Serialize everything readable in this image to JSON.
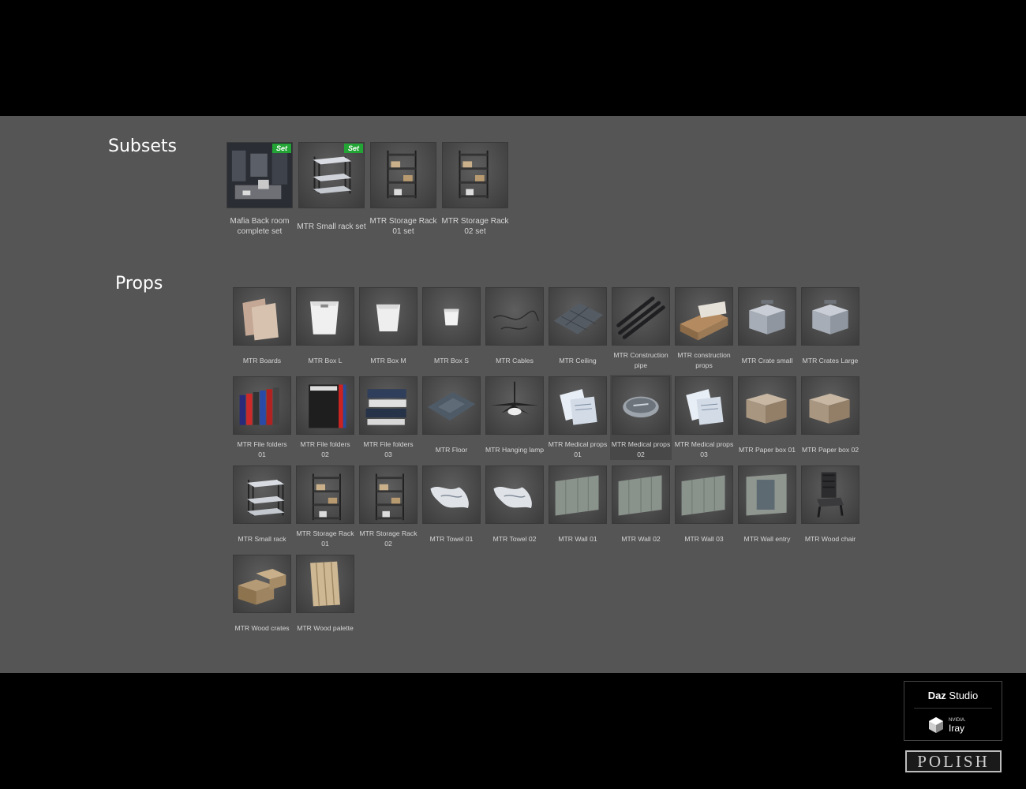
{
  "sections": {
    "subsets_title": "Subsets",
    "props_title": "Props"
  },
  "subsets": [
    {
      "lines": [
        "Mafia Back room",
        "complete set"
      ],
      "badge": "Set",
      "icon": "back-room-scene"
    },
    {
      "lines": [
        "MTR Small rack set"
      ],
      "badge": "Set",
      "icon": "small-rack"
    },
    {
      "lines": [
        "MTR Storage Rack",
        "01 set"
      ],
      "badge": "",
      "icon": "storage-rack"
    },
    {
      "lines": [
        "MTR Storage Rack",
        "02 set"
      ],
      "badge": "",
      "icon": "storage-rack"
    }
  ],
  "props": [
    {
      "lines": [
        "MTR Boards"
      ],
      "icon": "boards"
    },
    {
      "lines": [
        "MTR Box L"
      ],
      "icon": "box-large"
    },
    {
      "lines": [
        "MTR Box M"
      ],
      "icon": "box-medium"
    },
    {
      "lines": [
        "MTR Box S"
      ],
      "icon": "box-small"
    },
    {
      "lines": [
        "MTR Cables"
      ],
      "icon": "cables"
    },
    {
      "lines": [
        "MTR Ceiling"
      ],
      "icon": "ceiling"
    },
    {
      "lines": [
        "MTR Construction",
        "pipe"
      ],
      "icon": "pipes"
    },
    {
      "lines": [
        "MTR construction",
        "props"
      ],
      "icon": "lumber"
    },
    {
      "lines": [
        "MTR Crate small"
      ],
      "icon": "metal-crate"
    },
    {
      "lines": [
        "MTR Crates Large"
      ],
      "icon": "metal-crate"
    },
    {
      "lines": [
        "MTR File folders",
        "01"
      ],
      "icon": "file-folders"
    },
    {
      "lines": [
        "MTR File folders",
        "02"
      ],
      "icon": "binder"
    },
    {
      "lines": [
        "MTR File folders",
        "03"
      ],
      "icon": "folder-stack"
    },
    {
      "lines": [
        "MTR Floor"
      ],
      "icon": "floor"
    },
    {
      "lines": [
        "MTR Hanging lamp"
      ],
      "icon": "ceiling-fan"
    },
    {
      "lines": [
        "MTR Medical props",
        "01"
      ],
      "icon": "papers"
    },
    {
      "lines": [
        "MTR Medical props",
        "02"
      ],
      "icon": "bowl"
    },
    {
      "lines": [
        "MTR Medical props",
        "03"
      ],
      "icon": "papers"
    },
    {
      "lines": [
        "MTR Paper box 01"
      ],
      "icon": "cardboard-box"
    },
    {
      "lines": [
        "MTR Paper box 02"
      ],
      "icon": "cardboard-box"
    },
    {
      "lines": [
        "MTR Small rack"
      ],
      "icon": "small-rack"
    },
    {
      "lines": [
        "MTR Storage Rack",
        "01"
      ],
      "icon": "storage-rack"
    },
    {
      "lines": [
        "MTR Storage Rack",
        "02"
      ],
      "icon": "storage-rack"
    },
    {
      "lines": [
        "MTR Towel 01"
      ],
      "icon": "towel"
    },
    {
      "lines": [
        "MTR Towel 02"
      ],
      "icon": "towel"
    },
    {
      "lines": [
        "MTR Wall 01"
      ],
      "icon": "wall"
    },
    {
      "lines": [
        "MTR Wall 02"
      ],
      "icon": "wall"
    },
    {
      "lines": [
        "MTR Wall 03"
      ],
      "icon": "wall"
    },
    {
      "lines": [
        "MTR Wall entry"
      ],
      "icon": "wall-entry"
    },
    {
      "lines": [
        "MTR Wood chair"
      ],
      "icon": "chair"
    },
    {
      "lines": [
        "MTR Wood crates"
      ],
      "icon": "wood-crates"
    },
    {
      "lines": [
        "MTR Wood palette"
      ],
      "icon": "wood-palette"
    }
  ],
  "highlighted_prop": "MTR Medical props",
  "branding": {
    "daz_bold": "Daz",
    "daz_rest": " Studio",
    "nvidia": "NVIDIA.",
    "iray": "Iray",
    "polish": "POLISH"
  },
  "colors": {
    "panel": "#555555",
    "badge": "#22a534"
  }
}
